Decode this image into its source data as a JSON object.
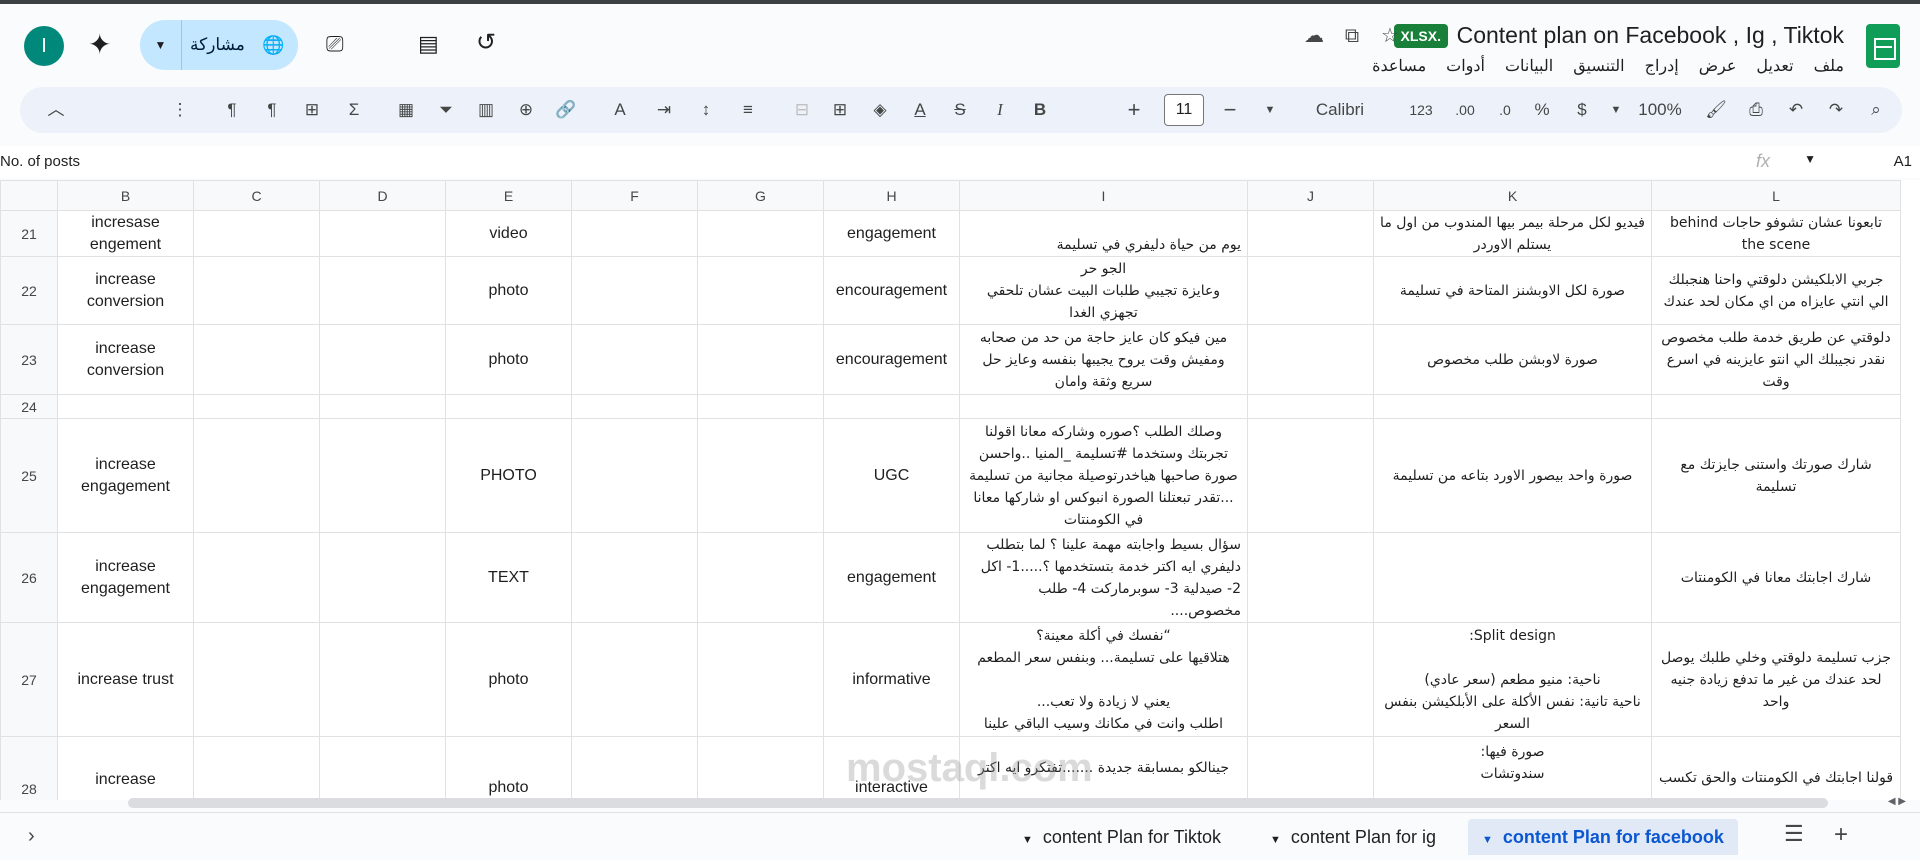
{
  "header": {
    "title": "Content plan  on Facebook , Ig , Tiktok",
    "badge": "XLSX.",
    "menu": [
      "ملف",
      "تعديل",
      "عرض",
      "إدراج",
      "التنسيق",
      "البيانات",
      "أدوات",
      "مساعدة"
    ],
    "share_label": "مشاركة",
    "avatar_letter": "I"
  },
  "toolbar": {
    "zoom": "100%",
    "currency": "$",
    "percent": "%",
    "dec_decrease": ".0",
    "dec_increase": ".00",
    "number_format": "123",
    "font": "Calibri",
    "font_size": "11"
  },
  "formula_bar": {
    "cell_ref": "A1",
    "content": "No. of posts",
    "fx": "fx"
  },
  "grid": {
    "columns": [
      "B",
      "C",
      "D",
      "E",
      "F",
      "G",
      "H",
      "I",
      "J",
      "K",
      "L"
    ],
    "rows": [
      {
        "num": "21",
        "B": "incresase engement",
        "E": "video",
        "H": "engagement",
        "I": "يوم من حياة دليفري في تسليمة",
        "K": "فيديو لكل مرحلة بيمر بيها المندوب من اول ما يستلم الاوردر",
        "L": "تابعونا  عشان تشوفو حاجات behind the scene"
      },
      {
        "num": "22",
        "B": "increase conversion",
        "E": "photo",
        "H": "encouragement",
        "I": "الجو حر\nوعايزة تجيبي طلبات البيت عشان تلحقي تجهزي الغدا",
        "K": "صورة لكل الاوبشنز المتاحة في تسليمة",
        "L": "جربي الابلكيشن دلوقتي واحنا هنجبلك الي انتي عايزاه من اي مكان لحد عندك"
      },
      {
        "num": "23",
        "B": "increase conversion",
        "E": "photo",
        "H": "encouragement",
        "I": "مين فيكو كان عايز حاجة من حد من صحابه ومفيش وقت يروح يجيبها بنفسه وعايز حل سريع وثقة وامان",
        "K": "صورة لاوبشن طلب مخصوص",
        "L": "دلوقتي عن طريق خدمة طلب مخصوص نقدر نجيبلك الي انتو عايزينه في اسرع وقت"
      },
      {
        "num": "24",
        "B": "",
        "E": "",
        "H": "",
        "I": "",
        "K": "",
        "L": ""
      },
      {
        "num": "25",
        "B": "increase engagement",
        "E": "PHOTO",
        "H": "UGC",
        "I": "وصلك الطلب ؟صوره وشاركه معانا اقولنا تجربتك  وستخدما #تسليمة _المنيا ..واحسن صورة صاحبها هياخدرتوصيلة مجانية من تسليمة ...تقدر تبعتلنا الصورة انبوكس او شاركها معانا في الكومنتات",
        "K": "صورة واحد بيصور الاورد بتاعه من تسليمة",
        "L": "شارك صورتك واستنى جايزتك مع تسليمة"
      },
      {
        "num": "26",
        "B": "increase engagement",
        "E": "TEXT",
        "H": "engagement",
        "I": "سؤال بسيط واجابته مهمة علينا ؟   لما بتطلب دليفري ايه اكتر خدمة بتستخدمها ؟.....1- اكل 2- صيدلية  3- سوبرماركت  4- طلب مخصوص....",
        "K": "",
        "L": "شارك اجابتك معانا في الكومنتات"
      },
      {
        "num": "27",
        "B": "increase trust",
        "E": "photo",
        "H": "informative",
        "I": "“نفسك في أكلة معينة؟\nهتلاقيها على تسليمة... وبنفس سعر المطعم\n\nيعني لا زيادة ولا تعب...\nاطلب وانت في مكانك وسيب الباقي علينا",
        "K": "Split design:\n\nناحية: منيو مطعم (سعر عادي)\nناحية تانية: نفس الأكلة على الأبلكيشن بنفس السعر",
        "L": "جزب تسليمة دلوقتي وخلي طلبك يوصل لحد عندك من غير ما تدفع زيادة جنيه واحد"
      },
      {
        "num": "28",
        "B": "increase",
        "E": "photo",
        "H": "interactive",
        "I": "جينالكو بمسابقة جديدة  .......تفتكرو ايه اكتر",
        "K": "صورة فيها:\nسندوتشات",
        "L": "قولنا اجابتك في الكومنتات والحق تكسب"
      }
    ]
  },
  "sheets": {
    "tabs": [
      "content Plan for Tiktok",
      "content Plan for ig",
      "content Plan for facebook"
    ],
    "active": "content Plan for facebook"
  },
  "watermark": "mostaql.com"
}
